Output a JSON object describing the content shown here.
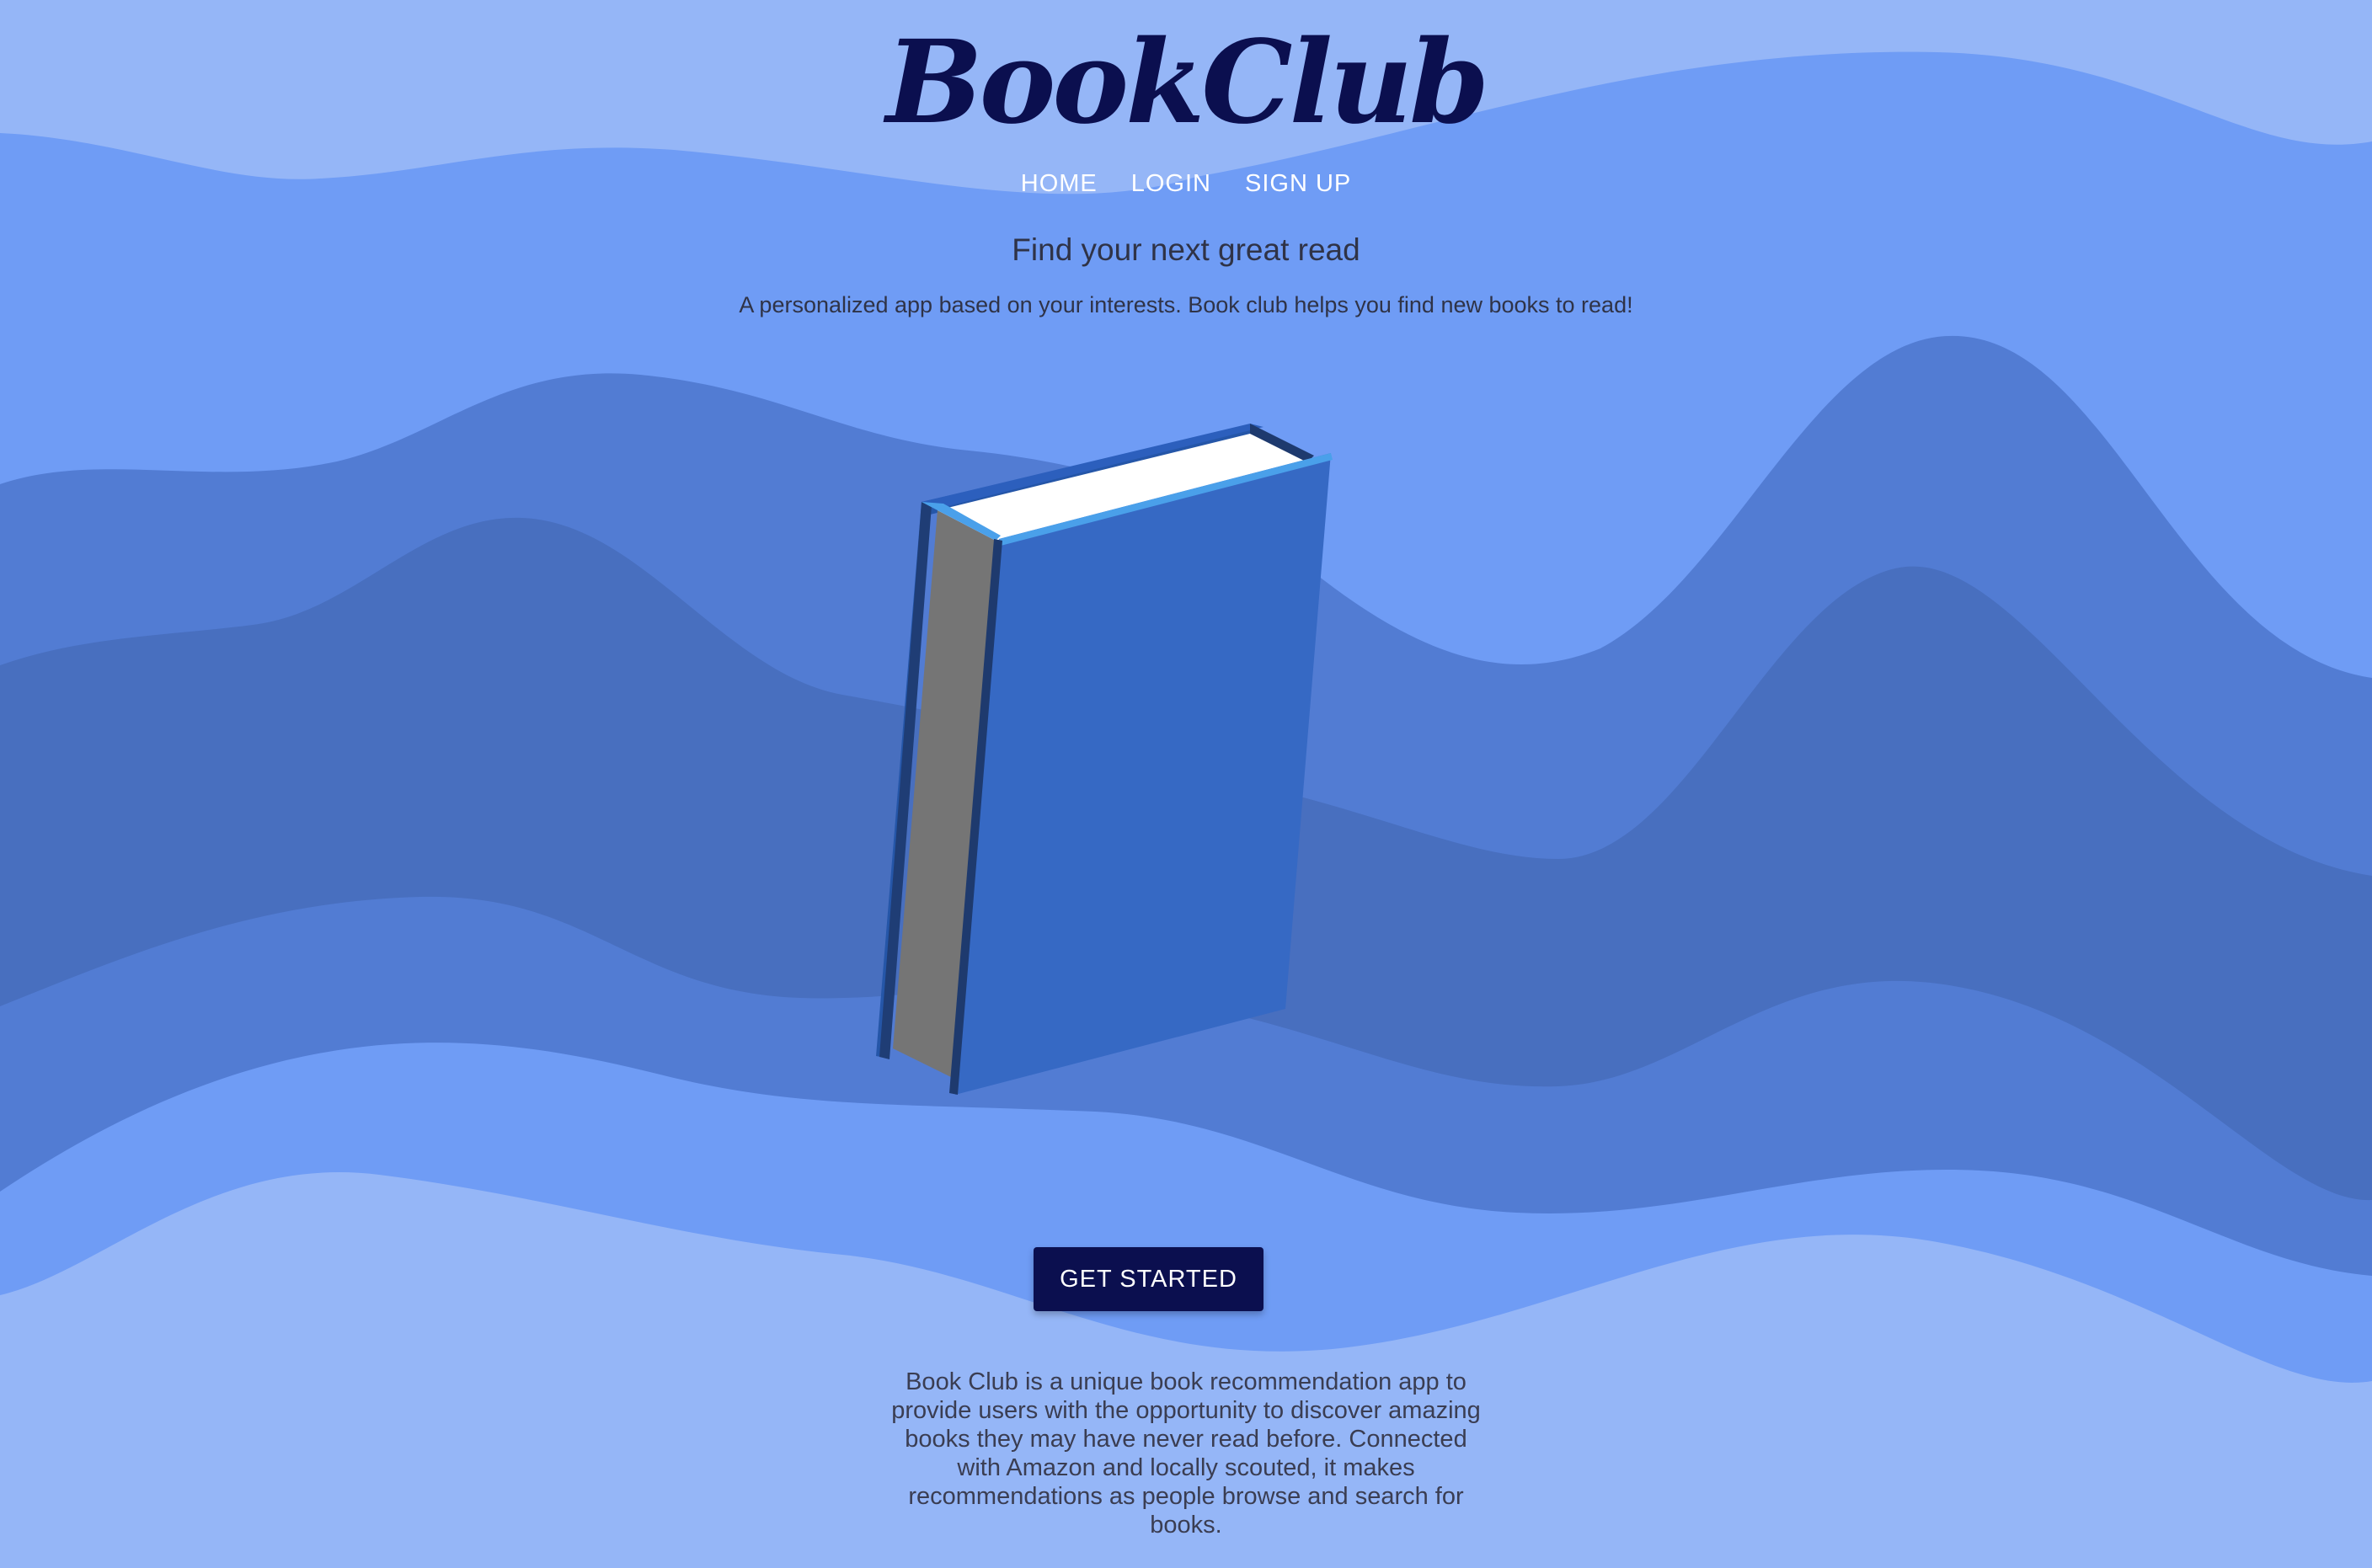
{
  "brand": {
    "name": "BookClub"
  },
  "nav": {
    "items": [
      {
        "label": "HOME"
      },
      {
        "label": "LOGIN"
      },
      {
        "label": "SIGN UP"
      }
    ]
  },
  "hero": {
    "tagline": "Find your next great read",
    "subtitle": "A personalized app based on your interests. Book club helps you find new books to read!"
  },
  "cta": {
    "label": "GET STARTED"
  },
  "about": {
    "text": "Book Club is a unique book recommendation app to provide users with the opportunity to discover amazing books they may have never read before. Connected with Amazon and locally scouted, it makes recommendations as people browse and search for books."
  },
  "colors": {
    "background_light": "#95b6f7",
    "wave_1": "#6f9cf5",
    "wave_2": "#527cd3",
    "wave_3": "#486fbf",
    "brand_navy": "#0b0f4f",
    "book_cover": "#3669c4",
    "book_pages": "#ffffff",
    "book_spine": "#757575"
  },
  "icons": {
    "illustration": "book-icon"
  }
}
